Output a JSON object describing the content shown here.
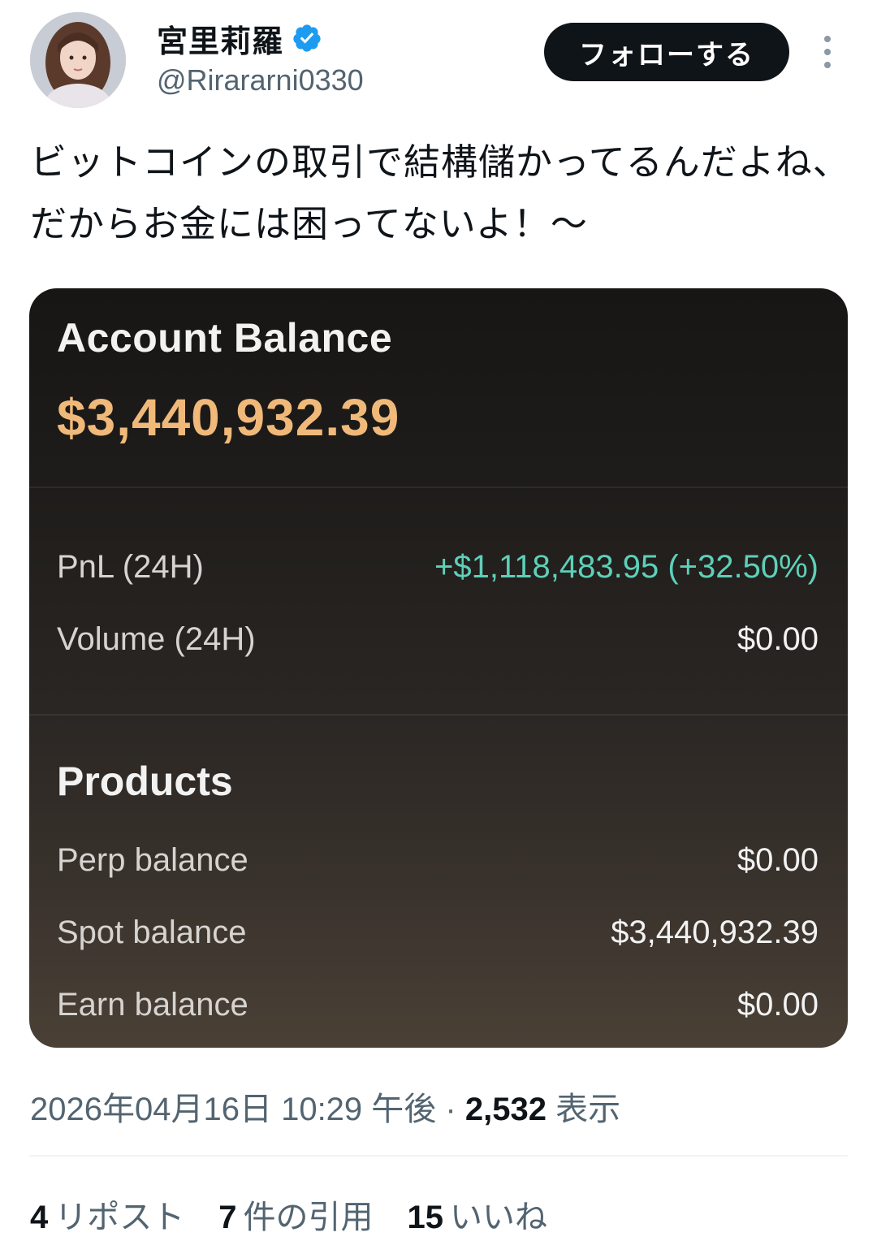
{
  "user": {
    "display_name": "宮里莉羅",
    "handle": "@Rirararni0330",
    "verified": true,
    "verified_color": "#1d9bf0"
  },
  "actions": {
    "follow_label": "フォローする",
    "more_icon": "more-vertical-icon"
  },
  "tweet": {
    "text": "ビットコインの取引で結構儲かってるんだよね、だからお金には困ってないよ！〜"
  },
  "card": {
    "title": "Account Balance",
    "total": "$3,440,932.39",
    "total_color": "#f0b97a",
    "rows": {
      "pnl": {
        "label": "PnL (24H)",
        "value": "+$1,118,483.95 (+32.50%)",
        "color": "#5ed0b8"
      },
      "volume": {
        "label": "Volume (24H)",
        "value": "$0.00"
      }
    },
    "products_title": "Products",
    "products": {
      "perp": {
        "label": "Perp balance",
        "value": "$0.00"
      },
      "spot": {
        "label": "Spot balance",
        "value": "$3,440,932.39"
      },
      "earn": {
        "label": "Earn balance",
        "value": "$0.00"
      }
    }
  },
  "meta": {
    "timestamp": "2026年04月16日 10:29 午後",
    "separator": " · ",
    "views_count": "2,532",
    "views_label": " 表示"
  },
  "stats": {
    "reposts": {
      "count": "4",
      "label": "リポスト"
    },
    "quotes": {
      "count": "7",
      "label": "件の引用"
    },
    "likes": {
      "count": "15",
      "label": "いいね"
    }
  }
}
